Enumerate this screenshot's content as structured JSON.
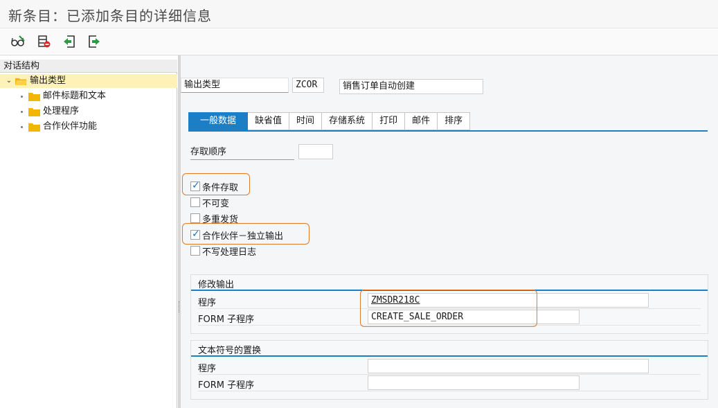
{
  "window": {
    "title": "新条目：已添加条目的详细信息"
  },
  "toolbar": {
    "buttons": [
      {
        "name": "display-change-toggle",
        "icon": "glasses-pencil-icon"
      },
      {
        "name": "delete-entry",
        "icon": "delete-row-icon"
      },
      {
        "name": "previous-entry",
        "icon": "back-arrow-icon"
      },
      {
        "name": "next-entry",
        "icon": "forward-arrow-icon"
      }
    ]
  },
  "tree": {
    "header": "对话结构",
    "root": {
      "label": "输出类型",
      "expanded": true,
      "selected": true
    },
    "children": [
      {
        "label": "邮件标题和文本"
      },
      {
        "label": "处理程序"
      },
      {
        "label": "合作伙伴功能"
      }
    ]
  },
  "output_type": {
    "label": "输出类型",
    "code": "ZCOR",
    "description": "销售订单自动创建"
  },
  "tabs": [
    {
      "label": "一般数据",
      "active": true
    },
    {
      "label": "缺省值"
    },
    {
      "label": "时间"
    },
    {
      "label": "存储系统"
    },
    {
      "label": "打印"
    },
    {
      "label": "邮件"
    },
    {
      "label": "排序"
    }
  ],
  "general": {
    "access_sequence_label": "存取顺序",
    "access_sequence_value": "",
    "checkboxes": [
      {
        "label": "条件存取",
        "checked": true,
        "highlighted": true
      },
      {
        "label": "不可变",
        "checked": false
      },
      {
        "label": "多重发货",
        "checked": false
      },
      {
        "label": "合作伙伴－独立输出",
        "checked": true,
        "highlighted": true
      },
      {
        "label": "不写处理日志",
        "checked": false
      }
    ]
  },
  "modify_output": {
    "title": "修改输出",
    "program_label": "程序",
    "program_value": "ZMSDR218C",
    "form_label": "FORM 子程序",
    "form_value": "CREATE_SALE_ORDER"
  },
  "text_symbols": {
    "title": "文本符号的置换",
    "program_label": "程序",
    "program_value": "",
    "form_label": "FORM 子程序",
    "form_value": ""
  },
  "colors": {
    "accent": "#1c7ec4",
    "highlight": "#e07b2a",
    "folder": "#f2b705",
    "selection": "#fff2b8"
  }
}
